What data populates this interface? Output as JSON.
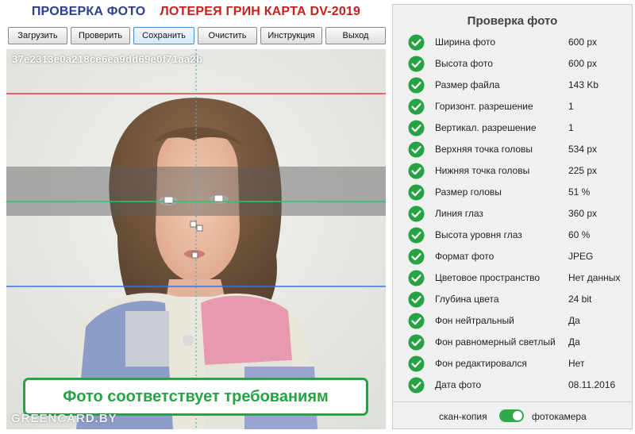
{
  "header": {
    "title_part1": "ПРОВЕРКА ФОТО",
    "title_part2": "ЛОТЕРЕЯ ГРИН КАРТА DV-2019"
  },
  "toolbar": {
    "load_label": "Загрузить",
    "check_label": "Проверить",
    "save_label": "Сохранить",
    "clear_label": "Очистить",
    "instructions_label": "Инструкция",
    "exit_label": "Выход"
  },
  "photo": {
    "hash": "37e2313e0a218ce6ea9dd69e0f71aa2b",
    "status_text": "Фото соответствует требованиям",
    "watermark": "GREENCARD.BY"
  },
  "panel": {
    "title": "Проверка фото",
    "checks": [
      {
        "label": "Ширина фото",
        "value": "600 px",
        "status": "ok"
      },
      {
        "label": "Высота фото",
        "value": "600 px",
        "status": "ok"
      },
      {
        "label": "Размер файла",
        "value": "143 Kb",
        "status": "ok"
      },
      {
        "label": "Горизонт. разрешение",
        "value": "1",
        "status": "ok"
      },
      {
        "label": "Вертикал. разрешение",
        "value": "1",
        "status": "ok"
      },
      {
        "label": "Верхняя точка головы",
        "value": "534 px",
        "status": "ok"
      },
      {
        "label": "Нижняя точка головы",
        "value": "225 px",
        "status": "ok"
      },
      {
        "label": "Размер головы",
        "value": "51 %",
        "status": "ok"
      },
      {
        "label": "Линия глаз",
        "value": "360 px",
        "status": "ok"
      },
      {
        "label": "Высота уровня глаз",
        "value": "60 %",
        "status": "ok"
      },
      {
        "label": "Формат фото",
        "value": "JPEG",
        "status": "ok"
      },
      {
        "label": "Цветовое пространство",
        "value": "Нет данных",
        "status": "ok"
      },
      {
        "label": "Глубина цвета",
        "value": "24 bit",
        "status": "ok"
      },
      {
        "label": "Фон нейтральный",
        "value": "Да",
        "status": "ok"
      },
      {
        "label": "Фон равномерный светлый",
        "value": "Да",
        "status": "ok"
      },
      {
        "label": "Фон редактировался",
        "value": "Нет",
        "status": "ok"
      },
      {
        "label": "Дата фото",
        "value": "08.11.2016",
        "status": "ok"
      }
    ],
    "toggle": {
      "left_label": "скан-копия",
      "right_label": "фотокамера",
      "selected": "фотокамера"
    }
  },
  "colors": {
    "title_blue": "#2c3f8f",
    "title_red": "#c8201a",
    "success_green": "#27a345",
    "top_line": "#e23b3b",
    "eye_line": "#31c26a",
    "chin_line": "#3d6fd8",
    "center_line": "#3ab7c9"
  },
  "icons": {
    "check": "check-circle-icon"
  }
}
